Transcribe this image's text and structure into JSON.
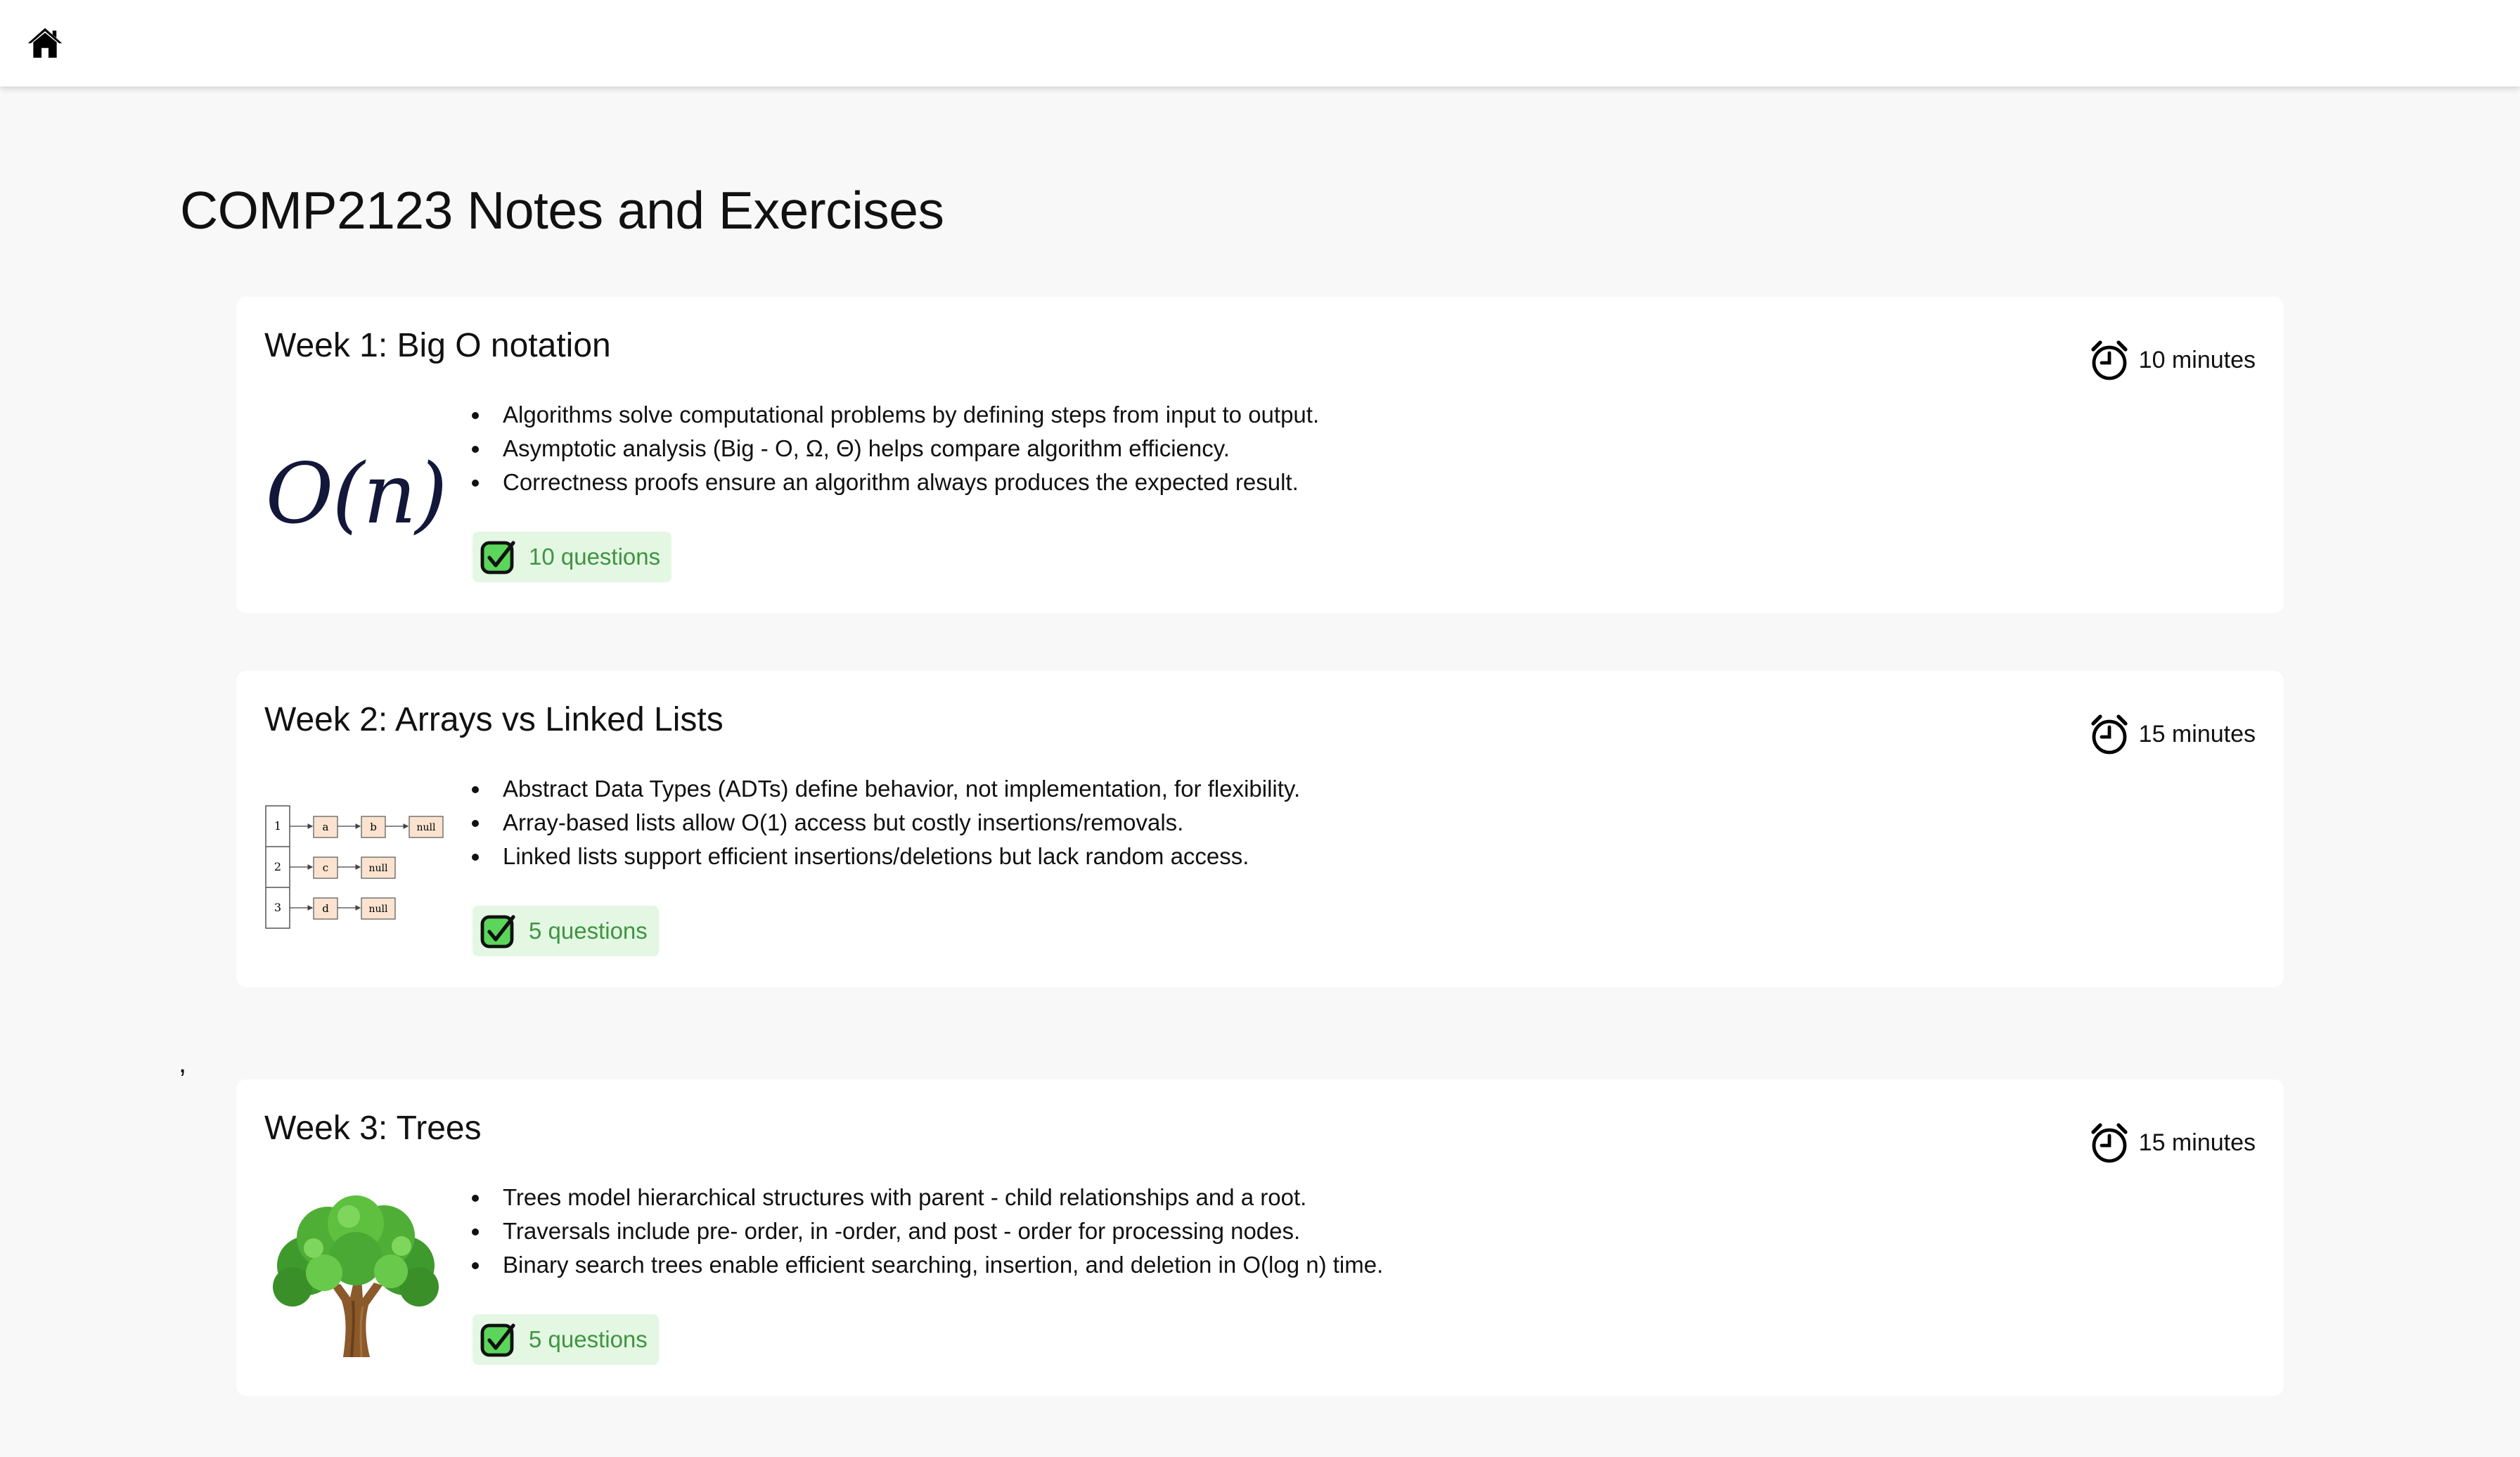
{
  "nav": {
    "home_icon": "home-icon"
  },
  "page": {
    "title": "COMP2123 Notes and Exercises",
    "stray_mark": ","
  },
  "colors": {
    "badge_bg": "#e3f7e3",
    "badge_text": "#3f9440",
    "card_bg": "#ffffff",
    "page_bg": "#f8f8f8"
  },
  "weeks": [
    {
      "title": "Week 1: Big O notation",
      "duration": "10 minutes",
      "thumbnail": "O(n)",
      "bullets": [
        "Algorithms solve computational problems by defining steps from input to output.",
        "Asymptotic analysis (Big - O, Ω, Θ) helps compare algorithm efficiency.",
        "Correctness proofs ensure an algorithm always produces the expected result."
      ],
      "questions": "10 questions"
    },
    {
      "title": "Week 2: Arrays vs Linked Lists",
      "duration": "15 minutes",
      "thumbnail": "linked-list-diagram",
      "diagram": {
        "rows": [
          "1",
          "2",
          "3"
        ],
        "nodes": [
          [
            "a",
            "b",
            "null"
          ],
          [
            "c",
            "null"
          ],
          [
            "d",
            "null"
          ]
        ]
      },
      "bullets": [
        "Abstract Data Types (ADTs) define behavior, not implementation, for flexibility.",
        "Array-based lists allow O(1) access but costly insertions/removals.",
        "Linked lists support efficient insertions/deletions but lack random access."
      ],
      "questions": "5 questions"
    },
    {
      "title": "Week 3: Trees",
      "duration": "15 minutes",
      "thumbnail": "tree-image",
      "bullets": [
        "Trees model hierarchical structures with parent - child relationships and a root.",
        "Traversals include pre- order, in -order, and post - order for processing nodes.",
        "Binary search trees enable efficient searching, insertion, and deletion in O(log n) time."
      ],
      "questions": "5 questions"
    }
  ]
}
